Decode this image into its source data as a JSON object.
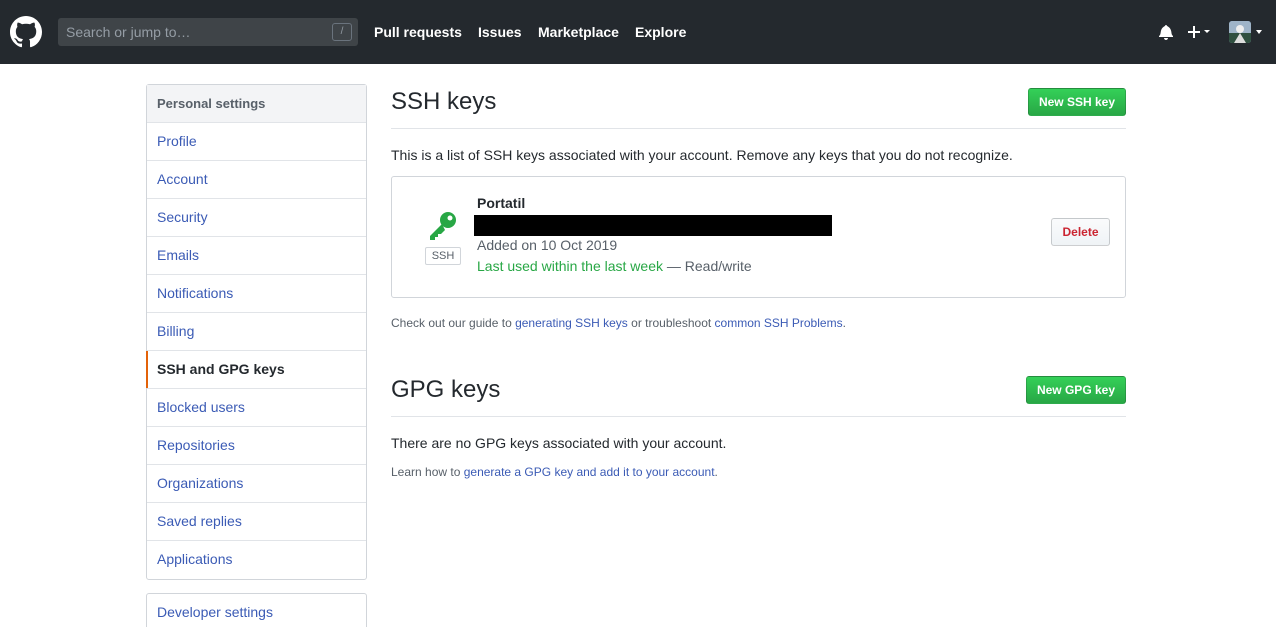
{
  "header": {
    "search_placeholder": "Search or jump to…",
    "search_shortcut": "/",
    "nav": [
      "Pull requests",
      "Issues",
      "Marketplace",
      "Explore"
    ]
  },
  "sidebar": {
    "heading": "Personal settings",
    "items": [
      {
        "label": "Profile"
      },
      {
        "label": "Account"
      },
      {
        "label": "Security"
      },
      {
        "label": "Emails"
      },
      {
        "label": "Notifications"
      },
      {
        "label": "Billing"
      },
      {
        "label": "SSH and GPG keys",
        "selected": true
      },
      {
        "label": "Blocked users"
      },
      {
        "label": "Repositories"
      },
      {
        "label": "Organizations"
      },
      {
        "label": "Saved replies"
      },
      {
        "label": "Applications"
      }
    ],
    "developer_settings": "Developer settings"
  },
  "ssh": {
    "title": "SSH keys",
    "new_button": "New SSH key",
    "description": "This is a list of SSH keys associated with your account. Remove any keys that you do not recognize.",
    "key": {
      "name": "Portatil",
      "type_label": "SSH",
      "added": "Added on 10 Oct 2019",
      "last_used": "Last used within the last week",
      "access": " — Read/write",
      "delete_button": "Delete"
    },
    "guide_prefix": "Check out our guide to ",
    "guide_link": "generating SSH keys",
    "guide_middle": " or troubleshoot ",
    "guide_link2": "common SSH Problems",
    "guide_suffix": "."
  },
  "gpg": {
    "title": "GPG keys",
    "new_button": "New GPG key",
    "empty_text": "There are no GPG keys associated with your account.",
    "learn_prefix": "Learn how to ",
    "learn_link": "generate a GPG key and add it to your account",
    "learn_suffix": "."
  },
  "colors": {
    "header_bg": "#24292e",
    "link": "#3b5bb5",
    "green": "#28a745",
    "danger": "#cb2431",
    "selected_accent": "#e36209"
  }
}
